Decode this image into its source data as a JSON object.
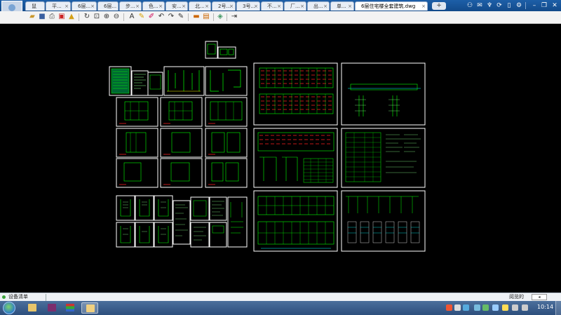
{
  "tabs": [
    {
      "label": "鼠"
    },
    {
      "label": "平..."
    },
    {
      "label": "6层..."
    },
    {
      "label": "6层..."
    },
    {
      "label": "步..."
    },
    {
      "label": "色..."
    },
    {
      "label": "安..."
    },
    {
      "label": "北..."
    },
    {
      "label": "2号..."
    },
    {
      "label": "3号..."
    },
    {
      "label": "不..."
    },
    {
      "label": "厂..."
    },
    {
      "label": "出..."
    },
    {
      "label": "单..."
    },
    {
      "label": "6层住宅楼全套建筑.dwg",
      "active": true
    }
  ],
  "new_tab_label": "+",
  "titlebar_icons": [
    "users-icon",
    "comment-icon",
    "shirt-icon",
    "refresh-icon",
    "phone-icon",
    "settings-icon",
    "minimize-icon",
    "restore-icon",
    "close-icon"
  ],
  "toolbar_icons": [
    "open-icon",
    "save-icon",
    "print-icon",
    "pdf-icon",
    "lock-icon",
    "rotate-icon",
    "zoom-window-icon",
    "zoom-in-icon",
    "zoom-out-icon",
    "text-icon",
    "pen-icon",
    "eraser-icon",
    "undo-icon",
    "redo-icon",
    "edit-icon",
    "measure-icon",
    "area-icon",
    "layers-icon",
    "export-icon"
  ],
  "status": {
    "item": "设备清单",
    "right_label": "阅览的",
    "button_label": "◂"
  },
  "clock": "10:14",
  "colors": {
    "cad_green": "#00ff00",
    "cad_red": "#ff2020",
    "cad_white": "#ffffff",
    "cad_yellow": "#ffff00",
    "cad_cyan": "#00ffff"
  }
}
